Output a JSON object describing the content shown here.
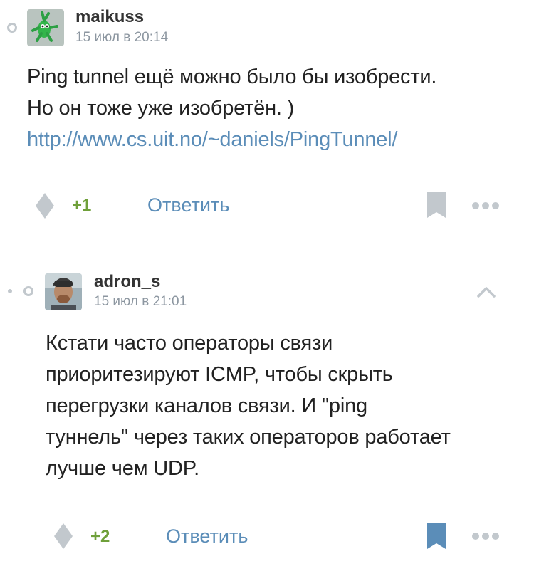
{
  "comments": [
    {
      "username": "maikuss",
      "timestamp": "15 июл в 20:14",
      "body": [
        "Ping tunnel ещё можно было бы изобрести.",
        "Но он тоже уже изобретён. )"
      ],
      "link": "http://www.cs.uit.no/~daniels/PingTunnel/",
      "score": "+1",
      "reply_label": "Ответить",
      "bookmarked": false,
      "avatar_icon": "green-creature-avatar"
    },
    {
      "username": "adron_s",
      "timestamp": "15 июл в 21:01",
      "body": [
        "Кстати часто операторы связи",
        "приоритезируют ICMP, чтобы скрыть",
        "перегрузки каналов связи. И \"ping",
        "туннель\" через таких операторов работает",
        "лучше чем UDP."
      ],
      "score": "+2",
      "reply_label": "Ответить",
      "bookmarked": true,
      "avatar_icon": "person-photo-avatar"
    }
  ],
  "colors": {
    "accent_blue": "#5b8db8",
    "positive_green": "#6fa03a",
    "icon_gray": "#c2c8cd",
    "meta_gray": "#8c96a0"
  }
}
